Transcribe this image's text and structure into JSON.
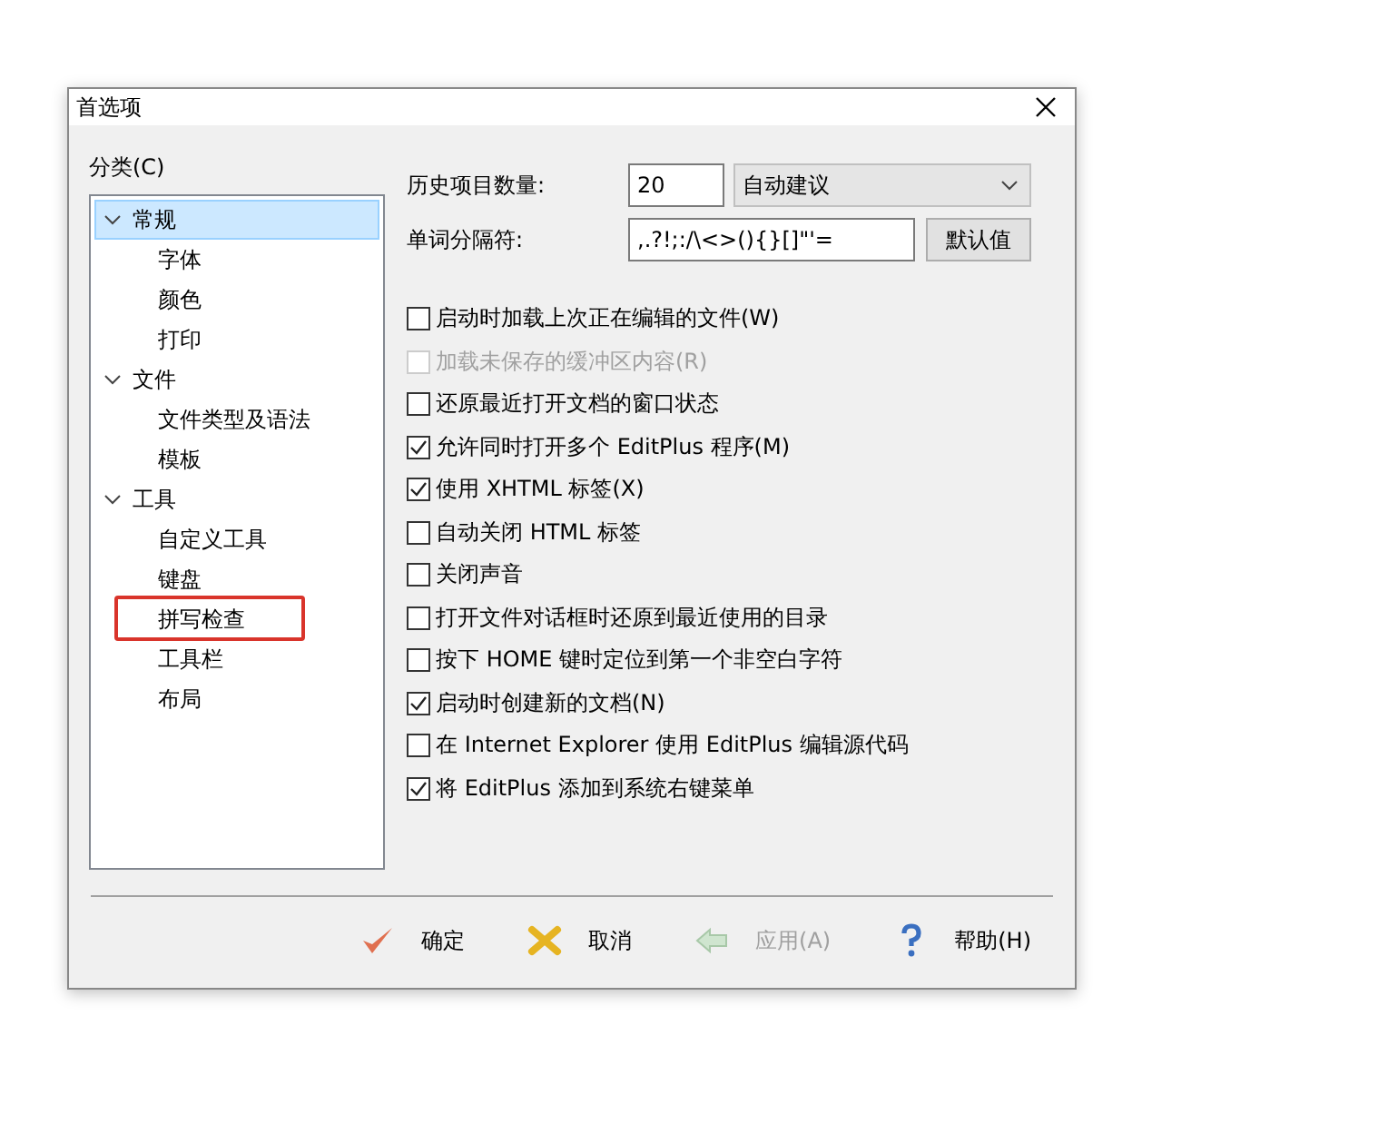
{
  "window": {
    "title": "首选项"
  },
  "category_label": "分类(C)",
  "tree": [
    {
      "label": "常规",
      "expanded": true,
      "selected": true,
      "highlighted": false,
      "children": [
        {
          "label": "字体",
          "selected": false,
          "highlighted": false
        },
        {
          "label": "颜色",
          "selected": false,
          "highlighted": false
        },
        {
          "label": "打印",
          "selected": false,
          "highlighted": false
        }
      ]
    },
    {
      "label": "文件",
      "expanded": true,
      "selected": false,
      "highlighted": false,
      "children": [
        {
          "label": "文件类型及语法",
          "selected": false,
          "highlighted": false
        },
        {
          "label": "模板",
          "selected": false,
          "highlighted": false
        }
      ]
    },
    {
      "label": "工具",
      "expanded": true,
      "selected": false,
      "highlighted": false,
      "children": [
        {
          "label": "自定义工具",
          "selected": false,
          "highlighted": false
        },
        {
          "label": "键盘",
          "selected": false,
          "highlighted": false
        },
        {
          "label": "拼写检查",
          "selected": false,
          "highlighted": true
        },
        {
          "label": "工具栏",
          "selected": false,
          "highlighted": false
        },
        {
          "label": "布局",
          "selected": false,
          "highlighted": false
        }
      ]
    }
  ],
  "history": {
    "label": "历史项目数量:",
    "value": "20",
    "dropdown": "自动建议"
  },
  "separators": {
    "label": "单词分隔符:",
    "value": ",.?!;:/\\<>(){}[]\"'=",
    "button": "默认值"
  },
  "options": [
    {
      "label": "启动时加载上次正在编辑的文件(W)",
      "checked": false,
      "disabled": false
    },
    {
      "label": "加载未保存的缓冲区内容(R)",
      "checked": false,
      "disabled": true
    },
    {
      "label": "还原最近打开文档的窗口状态",
      "checked": false,
      "disabled": false
    },
    {
      "label": "允许同时打开多个 EditPlus 程序(M)",
      "checked": true,
      "disabled": false
    },
    {
      "label": "使用 XHTML 标签(X)",
      "checked": true,
      "disabled": false
    },
    {
      "label": "自动关闭 HTML 标签",
      "checked": false,
      "disabled": false
    },
    {
      "label": "关闭声音",
      "checked": false,
      "disabled": false
    },
    {
      "label": "打开文件对话框时还原到最近使用的目录",
      "checked": false,
      "disabled": false
    },
    {
      "label": "按下 HOME 键时定位到第一个非空白字符",
      "checked": false,
      "disabled": false
    },
    {
      "label": "启动时创建新的文档(N)",
      "checked": true,
      "disabled": false
    },
    {
      "label": "在 Internet Explorer 使用 EditPlus 编辑源代码",
      "checked": false,
      "disabled": false
    },
    {
      "label": "将 EditPlus 添加到系统右键菜单",
      "checked": true,
      "disabled": false
    }
  ],
  "buttons": [
    {
      "kind": "ok",
      "label": "确定",
      "disabled": false
    },
    {
      "kind": "cancel",
      "label": "取消",
      "disabled": false
    },
    {
      "kind": "apply",
      "label": "应用(A)",
      "disabled": true
    },
    {
      "kind": "help",
      "label": "帮助(H)",
      "disabled": false
    }
  ]
}
